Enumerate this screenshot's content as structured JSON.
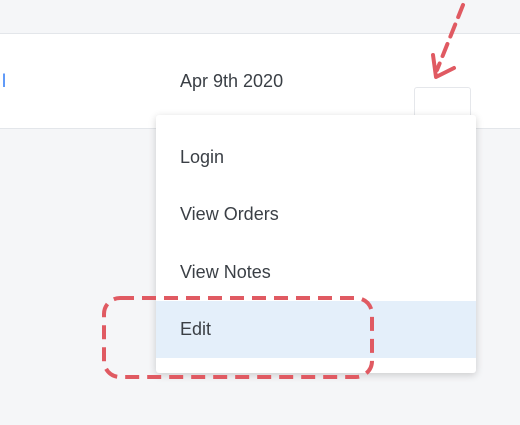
{
  "row": {
    "cut_text": "l",
    "date": "Apr 9th 2020"
  },
  "actions_button": {
    "glyph": "•••",
    "icon": "ellipsis-icon"
  },
  "menu": {
    "items": [
      {
        "label": "Login"
      },
      {
        "label": "View Orders"
      },
      {
        "label": "View Notes"
      },
      {
        "label": "Edit",
        "selected": true
      }
    ]
  },
  "annotation": {
    "color": "#e05a62",
    "arrow_icon": "dashed-arrow-icon",
    "highlight": "dashed-rounded-rect"
  },
  "colors": {
    "link": "#3b82f6",
    "selected_bg": "#e4effa",
    "dots": "#3b6fe5"
  }
}
